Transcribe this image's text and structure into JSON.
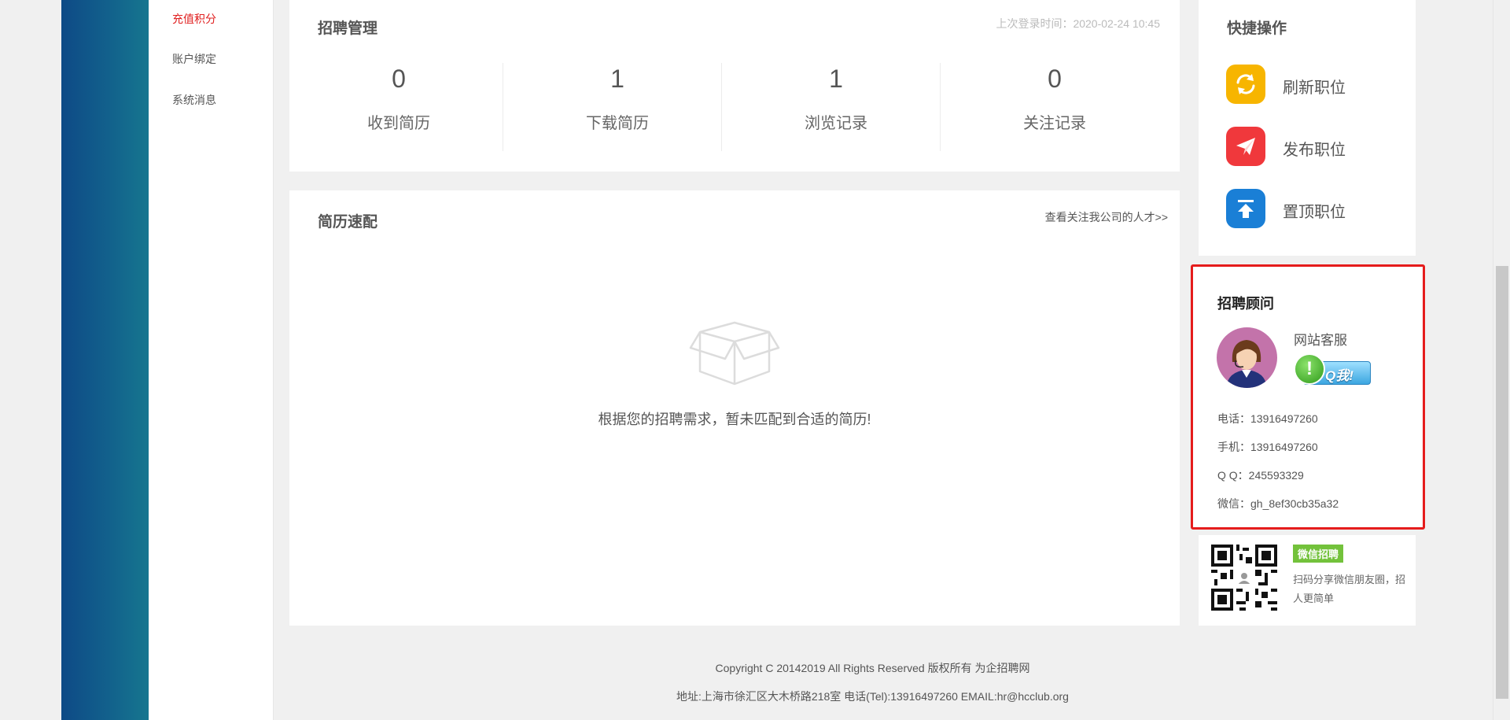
{
  "side_menu": {
    "items": [
      {
        "label": "充值积分",
        "active": true
      },
      {
        "label": "账户绑定",
        "active": false
      },
      {
        "label": "系统消息",
        "active": false
      }
    ]
  },
  "recruit": {
    "title": "招聘管理",
    "last_login": "上次登录时间：2020-02-24 10:45",
    "stats": [
      {
        "value": "0",
        "label": "收到简历"
      },
      {
        "value": "1",
        "label": "下载简历"
      },
      {
        "value": "1",
        "label": "浏览记录"
      },
      {
        "value": "0",
        "label": "关注记录"
      }
    ]
  },
  "match": {
    "title": "简历速配",
    "link": "查看关注我公司的人才>>",
    "empty_text": "根据您的招聘需求，暂未匹配到合适的简历!",
    "empty_icon": "empty-box-icon"
  },
  "quick": {
    "title": "快捷操作",
    "items": [
      {
        "label": "刷新职位",
        "icon": "refresh-icon",
        "color": "#f7b500"
      },
      {
        "label": "发布职位",
        "icon": "paper-plane-icon",
        "color": "#f0383c"
      },
      {
        "label": "置顶职位",
        "icon": "arrow-up-top-icon",
        "color": "#1a7fd6"
      }
    ]
  },
  "consultant": {
    "title": "招聘顾问",
    "name": "网站客服",
    "qq_button": "Q我!",
    "contacts": [
      {
        "label": "电话：",
        "value": "13916497260"
      },
      {
        "label": "手机：",
        "value": "13916497260"
      },
      {
        "label": "Q Q：",
        "value": "245593329"
      },
      {
        "label": "微信：",
        "value": "gh_8ef30cb35a32"
      }
    ]
  },
  "wechat": {
    "badge": "微信招聘",
    "tip": "扫码分享微信朋友圈，招人更简单"
  },
  "footer": {
    "copyright": "Copyright C 20142019 All Rights Reserved 版权所有 为企招聘网",
    "address": "地址:上海市徐汇区大木桥路218室 电话(Tel):13916497260 EMAIL:hr@hcclub.org"
  },
  "colors": {
    "accent_red": "#e51c1c",
    "sidebar_blue": "#0e4a86",
    "wechat_green": "#73c23b"
  }
}
